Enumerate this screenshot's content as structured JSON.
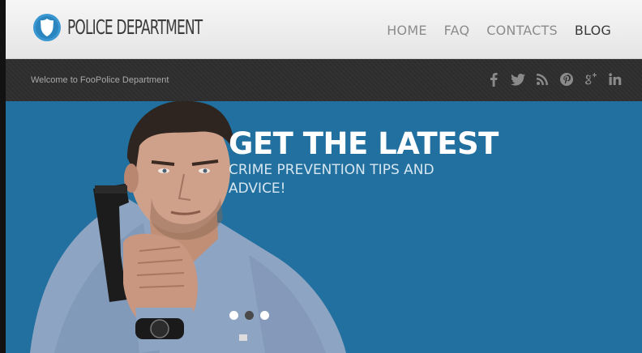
{
  "header": {
    "logo_text": "POLICE DEPARTMENT",
    "nav": [
      {
        "label": "HOME",
        "active": false
      },
      {
        "label": "FAQ",
        "active": false
      },
      {
        "label": "CONTACTS",
        "active": false
      },
      {
        "label": "BLOG",
        "active": true
      }
    ]
  },
  "topbar": {
    "welcome": "Welcome to FooPolice Department",
    "social_icons": [
      "facebook-icon",
      "twitter-icon",
      "rss-icon",
      "pinterest-icon",
      "google-plus-icon",
      "linkedin-icon"
    ]
  },
  "hero": {
    "headline": "GET THE LATEST",
    "subheadline": "CRIME PREVENTION TIPS AND ADVICE!",
    "slides_count": 3,
    "active_slide": 2
  },
  "colors": {
    "hero_bg": "#21709f",
    "topbar_bg": "#2e2e2e",
    "header_bg": "#eeeeee",
    "logo_badge": "#3a97d1"
  }
}
